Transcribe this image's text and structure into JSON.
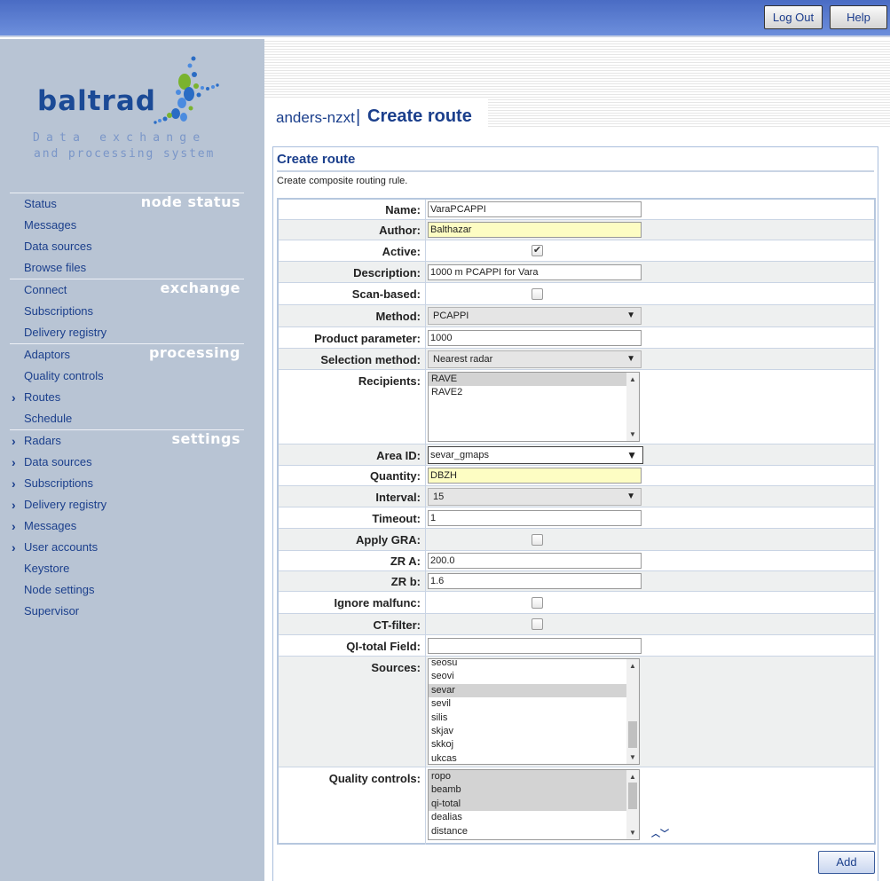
{
  "topbar": {
    "logout": "Log Out",
    "help": "Help"
  },
  "logo": {
    "name": "baltrad",
    "tagline1": "Data exchange",
    "tagline2": "and processing system"
  },
  "nav": {
    "sections": [
      "node status",
      "exchange",
      "processing",
      "settings"
    ],
    "items": [
      {
        "label": "Status",
        "expand": false
      },
      {
        "label": "Messages",
        "expand": false
      },
      {
        "label": "Data sources",
        "expand": false
      },
      {
        "label": "Browse files",
        "expand": false
      },
      {
        "label": "Connect",
        "expand": false
      },
      {
        "label": "Subscriptions",
        "expand": false
      },
      {
        "label": "Delivery registry",
        "expand": false
      },
      {
        "label": "Adaptors",
        "expand": false
      },
      {
        "label": "Quality controls",
        "expand": false
      },
      {
        "label": "Routes",
        "expand": true
      },
      {
        "label": "Schedule",
        "expand": false
      },
      {
        "label": "Radars",
        "expand": true
      },
      {
        "label": "Data sources",
        "expand": true
      },
      {
        "label": "Subscriptions",
        "expand": true
      },
      {
        "label": "Delivery registry",
        "expand": true
      },
      {
        "label": "Messages",
        "expand": true
      },
      {
        "label": "User accounts",
        "expand": true
      },
      {
        "label": "Keystore",
        "expand": false
      },
      {
        "label": "Node settings",
        "expand": false
      },
      {
        "label": "Supervisor",
        "expand": false
      }
    ]
  },
  "header": {
    "node": "anders-nzxt",
    "separator": "|",
    "title": "Create route"
  },
  "panel": {
    "title": "Create route",
    "description": "Create composite routing rule."
  },
  "form": {
    "name": {
      "label": "Name:",
      "value": "VaraPCAPPI"
    },
    "author": {
      "label": "Author:",
      "value": "Balthazar"
    },
    "active": {
      "label": "Active:",
      "checked": true
    },
    "description": {
      "label": "Description:",
      "value": "1000 m PCAPPI for Vara"
    },
    "scan_based": {
      "label": "Scan-based:",
      "checked": false
    },
    "method": {
      "label": "Method:",
      "value": "PCAPPI"
    },
    "product_parameter": {
      "label": "Product parameter:",
      "value": "1000"
    },
    "selection_method": {
      "label": "Selection method:",
      "value": "Nearest radar"
    },
    "recipients": {
      "label": "Recipients:",
      "options": [
        {
          "text": "RAVE",
          "selected": true
        },
        {
          "text": "RAVE2",
          "selected": false
        }
      ]
    },
    "area_id": {
      "label": "Area ID:",
      "value": "sevar_gmaps"
    },
    "quantity": {
      "label": "Quantity:",
      "value": "DBZH"
    },
    "interval": {
      "label": "Interval:",
      "value": "15"
    },
    "timeout": {
      "label": "Timeout:",
      "value": "1"
    },
    "apply_gra": {
      "label": "Apply GRA:",
      "checked": false
    },
    "zr_a": {
      "label": "ZR A:",
      "value": "200.0"
    },
    "zr_b": {
      "label": "ZR b:",
      "value": "1.6"
    },
    "ignore_malfunc": {
      "label": "Ignore malfunc:",
      "checked": false
    },
    "ct_filter": {
      "label": "CT-filter:",
      "checked": false
    },
    "qi_total_field": {
      "label": "QI-total Field:",
      "value": ""
    },
    "sources": {
      "label": "Sources:",
      "options": [
        {
          "text": "seosu",
          "selected": false
        },
        {
          "text": "seovi",
          "selected": false
        },
        {
          "text": "sevar",
          "selected": true
        },
        {
          "text": "sevil",
          "selected": false
        },
        {
          "text": "silis",
          "selected": false
        },
        {
          "text": "skjav",
          "selected": false
        },
        {
          "text": "skkoj",
          "selected": false
        },
        {
          "text": "ukcas",
          "selected": false
        }
      ]
    },
    "quality_controls": {
      "label": "Quality controls:",
      "options": [
        {
          "text": "ropo",
          "selected": true
        },
        {
          "text": "beamb",
          "selected": true
        },
        {
          "text": "qi-total",
          "selected": true
        },
        {
          "text": "dealias",
          "selected": false
        },
        {
          "text": "distance",
          "selected": false
        }
      ]
    }
  },
  "actions": {
    "add": "Add"
  }
}
